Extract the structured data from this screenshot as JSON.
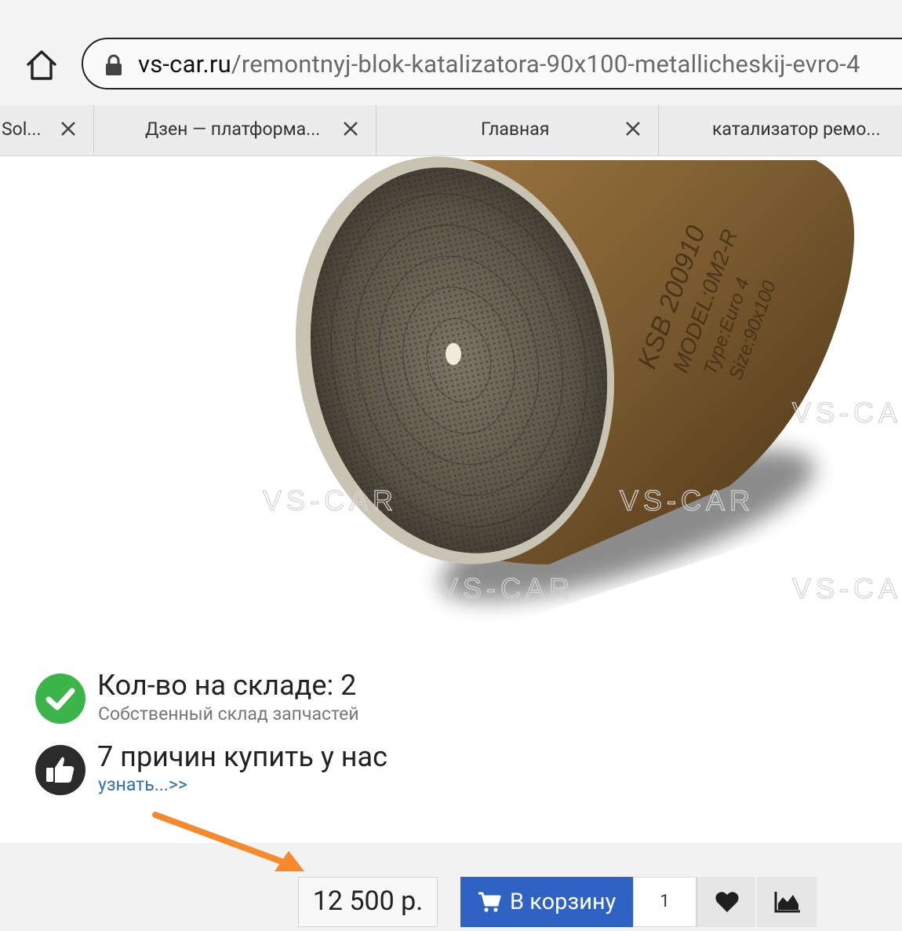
{
  "browser": {
    "url_host": "vs-car.ru",
    "url_path": "/remontnyj-blok-katalizatora-90x100-metallicheskij-evro-4"
  },
  "tabs": [
    {
      "label": "Sol..."
    },
    {
      "label": "Дзен — платформа..."
    },
    {
      "label": "Главная"
    },
    {
      "label": "катализатор ремо..."
    }
  ],
  "product": {
    "image_engraving": [
      "KSB 200910",
      "MODEL:0M2-R",
      "Type:Euro 4",
      "Size:90x100"
    ],
    "watermark": "VS-CAR"
  },
  "stock": {
    "title": "Кол-во на складе: 2",
    "subtitle": "Собственный склад запчастей"
  },
  "reasons": {
    "title": "7 причин купить у нас",
    "link": "узнать...>>"
  },
  "buy": {
    "price": "12 500 р.",
    "cart_label": "В корзину",
    "quantity": "1"
  },
  "colors": {
    "cart_button": "#2f62c2",
    "stock_ok": "#3bb54a",
    "arrow": "#f5892b",
    "link": "#2f6fb3"
  },
  "icons": [
    "home-icon",
    "lock-icon",
    "close-icon",
    "check-icon",
    "thumbs-up-icon",
    "cart-icon",
    "heart-icon",
    "chart-icon"
  ]
}
